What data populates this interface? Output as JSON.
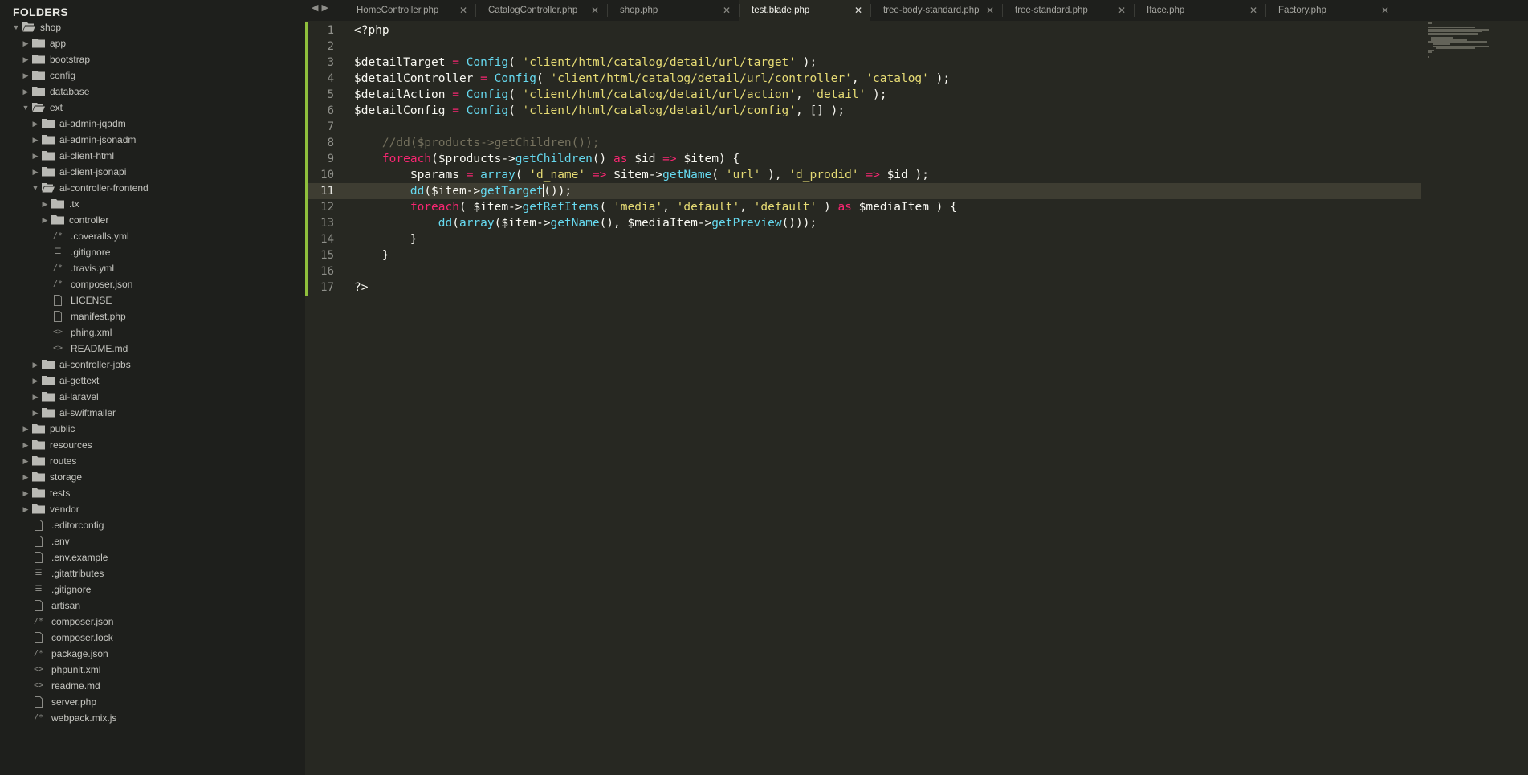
{
  "sidebar": {
    "title": "FOLDERS",
    "tree": [
      {
        "label": "shop",
        "kind": "folder-open",
        "depth": 0
      },
      {
        "label": "app",
        "kind": "folder",
        "depth": 1
      },
      {
        "label": "bootstrap",
        "kind": "folder",
        "depth": 1
      },
      {
        "label": "config",
        "kind": "folder",
        "depth": 1
      },
      {
        "label": "database",
        "kind": "folder",
        "depth": 1
      },
      {
        "label": "ext",
        "kind": "folder-open",
        "depth": 1
      },
      {
        "label": "ai-admin-jqadm",
        "kind": "folder",
        "depth": 2
      },
      {
        "label": "ai-admin-jsonadm",
        "kind": "folder",
        "depth": 2
      },
      {
        "label": "ai-client-html",
        "kind": "folder",
        "depth": 2
      },
      {
        "label": "ai-client-jsonapi",
        "kind": "folder",
        "depth": 2
      },
      {
        "label": "ai-controller-frontend",
        "kind": "folder-open",
        "depth": 2
      },
      {
        "label": ".tx",
        "kind": "folder",
        "depth": 3
      },
      {
        "label": "controller",
        "kind": "folder",
        "depth": 3
      },
      {
        "label": ".coveralls.yml",
        "kind": "file",
        "icon": "/*",
        "depth": 3
      },
      {
        "label": ".gitignore",
        "kind": "file",
        "icon": "☰",
        "depth": 3
      },
      {
        "label": ".travis.yml",
        "kind": "file",
        "icon": "/*",
        "depth": 3
      },
      {
        "label": "composer.json",
        "kind": "file",
        "icon": "/*",
        "depth": 3
      },
      {
        "label": "LICENSE",
        "kind": "file",
        "icon": "doc",
        "depth": 3
      },
      {
        "label": "manifest.php",
        "kind": "file",
        "icon": "doc",
        "depth": 3
      },
      {
        "label": "phing.xml",
        "kind": "file",
        "icon": "<>",
        "depth": 3
      },
      {
        "label": "README.md",
        "kind": "file",
        "icon": "<>",
        "depth": 3
      },
      {
        "label": "ai-controller-jobs",
        "kind": "folder",
        "depth": 2
      },
      {
        "label": "ai-gettext",
        "kind": "folder",
        "depth": 2
      },
      {
        "label": "ai-laravel",
        "kind": "folder",
        "depth": 2
      },
      {
        "label": "ai-swiftmailer",
        "kind": "folder",
        "depth": 2
      },
      {
        "label": "public",
        "kind": "folder",
        "depth": 1
      },
      {
        "label": "resources",
        "kind": "folder",
        "depth": 1
      },
      {
        "label": "routes",
        "kind": "folder",
        "depth": 1
      },
      {
        "label": "storage",
        "kind": "folder",
        "depth": 1
      },
      {
        "label": "tests",
        "kind": "folder",
        "depth": 1
      },
      {
        "label": "vendor",
        "kind": "folder",
        "depth": 1
      },
      {
        "label": ".editorconfig",
        "kind": "file",
        "icon": "doc",
        "depth": 1
      },
      {
        "label": ".env",
        "kind": "file",
        "icon": "doc",
        "depth": 1
      },
      {
        "label": ".env.example",
        "kind": "file",
        "icon": "doc",
        "depth": 1
      },
      {
        "label": ".gitattributes",
        "kind": "file",
        "icon": "☰",
        "depth": 1
      },
      {
        "label": ".gitignore",
        "kind": "file",
        "icon": "☰",
        "depth": 1
      },
      {
        "label": "artisan",
        "kind": "file",
        "icon": "doc",
        "depth": 1
      },
      {
        "label": "composer.json",
        "kind": "file",
        "icon": "/*",
        "depth": 1
      },
      {
        "label": "composer.lock",
        "kind": "file",
        "icon": "doc",
        "depth": 1
      },
      {
        "label": "package.json",
        "kind": "file",
        "icon": "/*",
        "depth": 1
      },
      {
        "label": "phpunit.xml",
        "kind": "file",
        "icon": "<>",
        "depth": 1
      },
      {
        "label": "readme.md",
        "kind": "file",
        "icon": "<>",
        "depth": 1
      },
      {
        "label": "server.php",
        "kind": "file",
        "icon": "doc",
        "depth": 1
      },
      {
        "label": "webpack.mix.js",
        "kind": "file",
        "icon": "/*",
        "depth": 1
      }
    ]
  },
  "nav": {
    "back": "◀",
    "forward": "▶"
  },
  "tabs": [
    {
      "label": "HomeController.php",
      "active": false,
      "close": "✕"
    },
    {
      "label": "CatalogController.php",
      "active": false,
      "close": "✕"
    },
    {
      "label": "shop.php",
      "active": false,
      "close": "✕"
    },
    {
      "label": "test.blade.php",
      "active": true,
      "close": "✕"
    },
    {
      "label": "tree-body-standard.php",
      "active": false,
      "close": "✕"
    },
    {
      "label": "tree-standard.php",
      "active": false,
      "close": "✕"
    },
    {
      "label": "Iface.php",
      "active": false,
      "close": "✕"
    },
    {
      "label": "Factory.php",
      "active": false,
      "close": "✕"
    }
  ],
  "editor": {
    "current_line": 11,
    "cursor_after_token": "getTarget",
    "lines": [
      [
        [
          "plain",
          "<?php"
        ]
      ],
      [],
      [
        [
          "plain",
          "$detailTarget "
        ],
        [
          "kw",
          "="
        ],
        [
          "plain",
          " "
        ],
        [
          "fn",
          "Config"
        ],
        [
          "plain",
          "( "
        ],
        [
          "str",
          "'client/html/catalog/detail/url/target'"
        ],
        [
          "plain",
          " );"
        ]
      ],
      [
        [
          "plain",
          "$detailController "
        ],
        [
          "kw",
          "="
        ],
        [
          "plain",
          " "
        ],
        [
          "fn",
          "Config"
        ],
        [
          "plain",
          "( "
        ],
        [
          "str",
          "'client/html/catalog/detail/url/controller'"
        ],
        [
          "plain",
          ", "
        ],
        [
          "str",
          "'catalog'"
        ],
        [
          "plain",
          " );"
        ]
      ],
      [
        [
          "plain",
          "$detailAction "
        ],
        [
          "kw",
          "="
        ],
        [
          "plain",
          " "
        ],
        [
          "fn",
          "Config"
        ],
        [
          "plain",
          "( "
        ],
        [
          "str",
          "'client/html/catalog/detail/url/action'"
        ],
        [
          "plain",
          ", "
        ],
        [
          "str",
          "'detail'"
        ],
        [
          "plain",
          " );"
        ]
      ],
      [
        [
          "plain",
          "$detailConfig "
        ],
        [
          "kw",
          "="
        ],
        [
          "plain",
          " "
        ],
        [
          "fn",
          "Config"
        ],
        [
          "plain",
          "( "
        ],
        [
          "str",
          "'client/html/catalog/detail/url/config'"
        ],
        [
          "plain",
          ", [] );"
        ]
      ],
      [],
      [
        [
          "plain",
          "    "
        ],
        [
          "cmt",
          "//dd($products->getChildren());"
        ]
      ],
      [
        [
          "plain",
          "    "
        ],
        [
          "kw",
          "foreach"
        ],
        [
          "plain",
          "($products->"
        ],
        [
          "fn",
          "getChildren"
        ],
        [
          "plain",
          "() "
        ],
        [
          "kw",
          "as"
        ],
        [
          "plain",
          " $id "
        ],
        [
          "kw",
          "=>"
        ],
        [
          "plain",
          " $item) {"
        ]
      ],
      [
        [
          "plain",
          "        $params "
        ],
        [
          "kw",
          "="
        ],
        [
          "plain",
          " "
        ],
        [
          "fn",
          "array"
        ],
        [
          "plain",
          "( "
        ],
        [
          "str",
          "'d_name'"
        ],
        [
          "plain",
          " "
        ],
        [
          "kw",
          "=>"
        ],
        [
          "plain",
          " $item->"
        ],
        [
          "fn",
          "getName"
        ],
        [
          "plain",
          "( "
        ],
        [
          "str",
          "'url'"
        ],
        [
          "plain",
          " ), "
        ],
        [
          "str",
          "'d_prodid'"
        ],
        [
          "plain",
          " "
        ],
        [
          "kw",
          "=>"
        ],
        [
          "plain",
          " $id );"
        ]
      ],
      [
        [
          "plain",
          "        "
        ],
        [
          "fn",
          "dd"
        ],
        [
          "plain",
          "($item->"
        ],
        [
          "fn",
          "getTarget"
        ],
        [
          "cursor",
          ""
        ],
        [
          "plain",
          "());"
        ]
      ],
      [
        [
          "plain",
          "        "
        ],
        [
          "kw",
          "foreach"
        ],
        [
          "plain",
          "( $item->"
        ],
        [
          "fn",
          "getRefItems"
        ],
        [
          "plain",
          "( "
        ],
        [
          "str",
          "'media'"
        ],
        [
          "plain",
          ", "
        ],
        [
          "str",
          "'default'"
        ],
        [
          "plain",
          ", "
        ],
        [
          "str",
          "'default'"
        ],
        [
          "plain",
          " ) "
        ],
        [
          "kw",
          "as"
        ],
        [
          "plain",
          " $mediaItem ) {"
        ]
      ],
      [
        [
          "plain",
          "            "
        ],
        [
          "fn",
          "dd"
        ],
        [
          "plain",
          "("
        ],
        [
          "fn",
          "array"
        ],
        [
          "plain",
          "($item->"
        ],
        [
          "fn",
          "getName"
        ],
        [
          "plain",
          "(), $mediaItem->"
        ],
        [
          "fn",
          "getPreview"
        ],
        [
          "plain",
          "()));"
        ]
      ],
      [
        [
          "plain",
          "        }"
        ]
      ],
      [
        [
          "plain",
          "    }"
        ]
      ],
      [],
      [
        [
          "plain",
          "?>"
        ]
      ]
    ]
  },
  "colors": {
    "background": "#272822",
    "sidebar": "#1e1f1c",
    "keyword": "#f92672",
    "string": "#e6db74",
    "function": "#66d9ef",
    "comment": "#75715e",
    "modified_bar": "#8fbf3c"
  }
}
